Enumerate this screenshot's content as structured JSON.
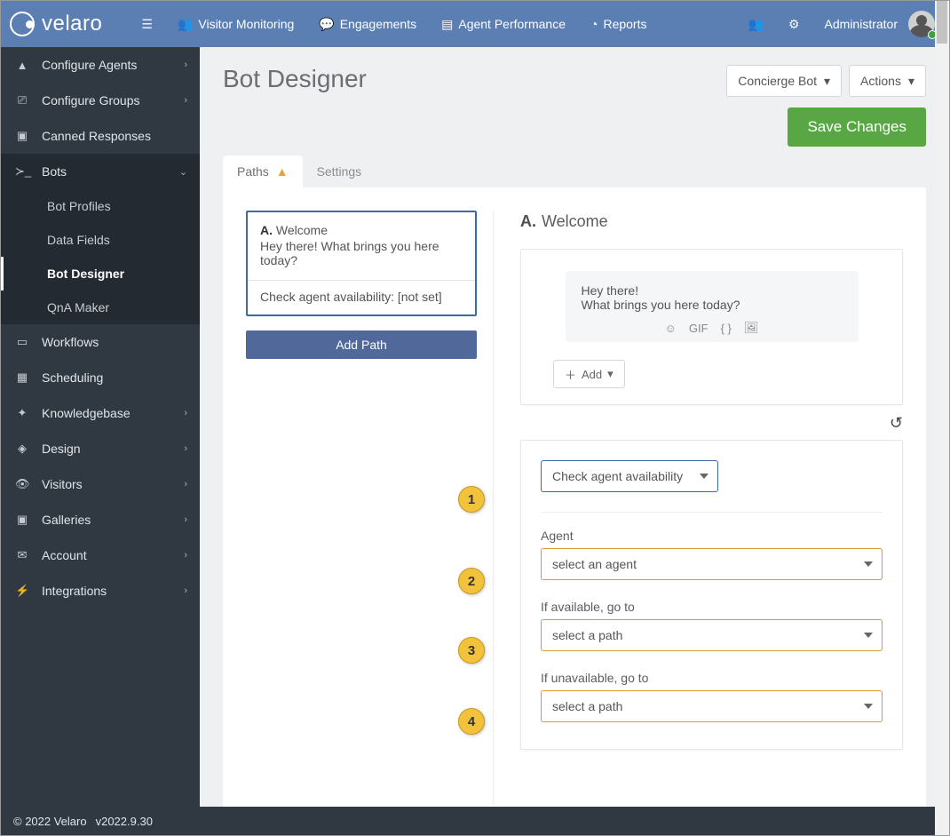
{
  "brand": "velaro",
  "topnav": {
    "visitor_monitoring": "Visitor Monitoring",
    "engagements": "Engagements",
    "agent_performance": "Agent Performance",
    "reports": "Reports",
    "user_label": "Administrator"
  },
  "sidebar": {
    "configure_agents": "Configure Agents",
    "configure_groups": "Configure Groups",
    "canned_responses": "Canned Responses",
    "bots": "Bots",
    "bots_sub": {
      "bot_profiles": "Bot Profiles",
      "data_fields": "Data Fields",
      "bot_designer": "Bot Designer",
      "qna_maker": "QnA Maker"
    },
    "workflows": "Workflows",
    "scheduling": "Scheduling",
    "knowledgebase": "Knowledgebase",
    "design": "Design",
    "visitors": "Visitors",
    "galleries": "Galleries",
    "account": "Account",
    "integrations": "Integrations"
  },
  "page": {
    "title": "Bot Designer",
    "bot_selector": "Concierge Bot",
    "actions_button": "Actions",
    "save_button": "Save Changes"
  },
  "tabs": {
    "paths": "Paths",
    "settings": "Settings"
  },
  "path_card": {
    "prefix": "A.",
    "name": "Welcome",
    "preview": "Hey there! What brings you here today?",
    "rule_line": "Check agent availability: [not set]"
  },
  "add_path_button": "Add Path",
  "detail": {
    "prefix": "A.",
    "title": "Welcome",
    "message_line1": "Hey there!",
    "message_line2": "What brings you here today?",
    "gif_label": "GIF",
    "add_button": "Add"
  },
  "logic": {
    "action_select": "Check agent availability",
    "agent_label": "Agent",
    "agent_value": "select an agent",
    "available_label": "If available, go to",
    "available_value": "select a path",
    "unavailable_label": "If unavailable, go to",
    "unavailable_value": "select a path"
  },
  "badges": {
    "b1": "1",
    "b2": "2",
    "b3": "3",
    "b4": "4"
  },
  "footer": {
    "copyright": "© 2022 Velaro",
    "version": "v2022.9.30"
  }
}
